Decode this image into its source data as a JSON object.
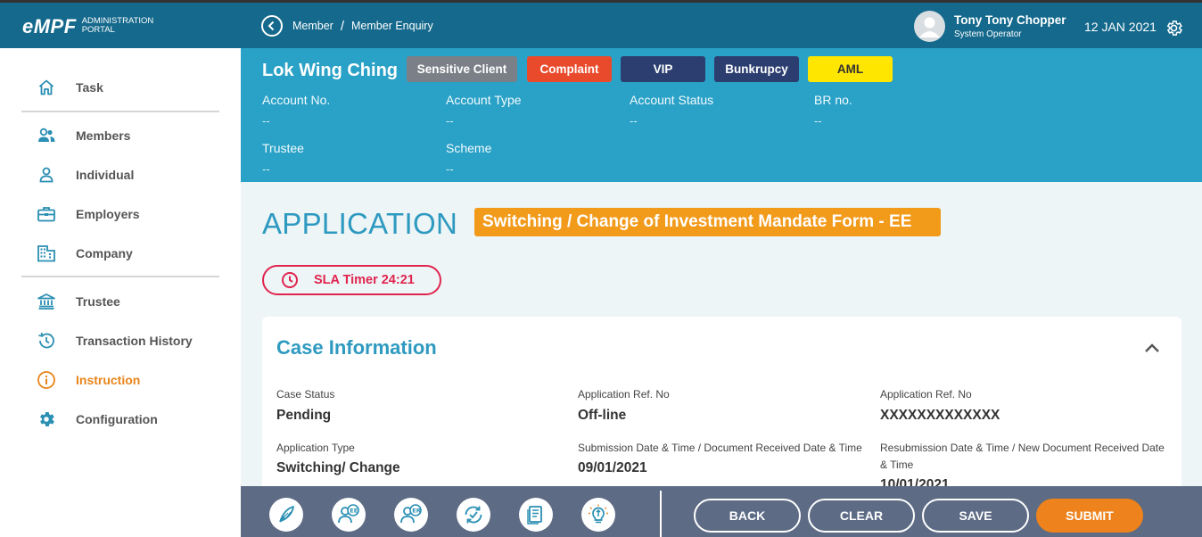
{
  "header": {
    "logo": "eMPF",
    "logo_sub_1": "ADMINISTRATION",
    "logo_sub_2": "PORTAL",
    "breadcrumb": [
      "Member",
      "Member Enquiry"
    ],
    "breadcrumb_sep": "/",
    "user_name": "Tony Tony Chopper",
    "user_role": "System Operator",
    "date": "12 JAN 2021"
  },
  "sidebar": {
    "items": [
      {
        "label": "Task",
        "icon": "home-icon"
      },
      {
        "label": "Members",
        "icon": "members-icon"
      },
      {
        "label": "Individual",
        "icon": "person-icon"
      },
      {
        "label": "Employers",
        "icon": "briefcase-icon"
      },
      {
        "label": "Company",
        "icon": "building-icon"
      },
      {
        "label": "Trustee",
        "icon": "bank-icon"
      },
      {
        "label": "Transaction History",
        "icon": "history-icon"
      },
      {
        "label": "Instruction",
        "icon": "info-icon",
        "active": true
      },
      {
        "label": "Configuration",
        "icon": "gear-icon"
      }
    ]
  },
  "member": {
    "name": "Lok Wing Ching",
    "tags": [
      {
        "label": "Sensitive Client",
        "bg": "#7b8088",
        "color": "#ffffff"
      },
      {
        "label": "Complaint",
        "bg": "#ea4a2c",
        "color": "#ffffff"
      },
      {
        "label": "VIP",
        "bg": "#2c3e70",
        "color": "#ffffff"
      },
      {
        "label": "Bunkrupcy",
        "bg": "#2c3e70",
        "color": "#ffffff"
      },
      {
        "label": "AML",
        "bg": "#ffe600",
        "color": "#333333"
      }
    ],
    "fields": [
      {
        "label": "Account No.",
        "value": "--"
      },
      {
        "label": "Account Type",
        "value": "--"
      },
      {
        "label": "Account Status",
        "value": "--"
      },
      {
        "label": "BR no.",
        "value": "--"
      },
      {
        "label": "Trustee",
        "value": "--"
      },
      {
        "label": "Scheme",
        "value": "--"
      }
    ]
  },
  "application": {
    "title": "APPLICATION",
    "form_name": "Switching / Change of Investment Mandate Form - EE",
    "sla_timer": "SLA Timer 24:21"
  },
  "case_info": {
    "title": "Case Information",
    "fields": [
      {
        "label": "Case Status",
        "value": "Pending"
      },
      {
        "label": "Application Ref. No",
        "value": "Off-line"
      },
      {
        "label": "Application Ref. No",
        "value": "XXXXXXXXXXXXX"
      },
      {
        "label": "Application Type",
        "value": "Switching/ Change"
      },
      {
        "label": "Submission Date & Time / Document Received Date & Time",
        "value": "09/01/2021"
      },
      {
        "label": "Resubmission Date & Time / New Document Received Date & Time",
        "value": "10/01/2021"
      }
    ]
  },
  "footer": {
    "icons": [
      "quill-icon",
      "ee-user-icon",
      "er-user-icon",
      "refresh-check-icon",
      "document-icon",
      "lightbulb-icon"
    ],
    "buttons": {
      "back": "BACK",
      "clear": "CLEAR",
      "save": "SAVE",
      "submit": "SUBMIT"
    }
  },
  "colors": {
    "topbar": "#14698c",
    "member_header": "#2aa1c6",
    "accent": "#2e9ac0",
    "orange": "#ee821c",
    "sla_red": "#e0244f",
    "bottombar": "#5d6b85"
  }
}
